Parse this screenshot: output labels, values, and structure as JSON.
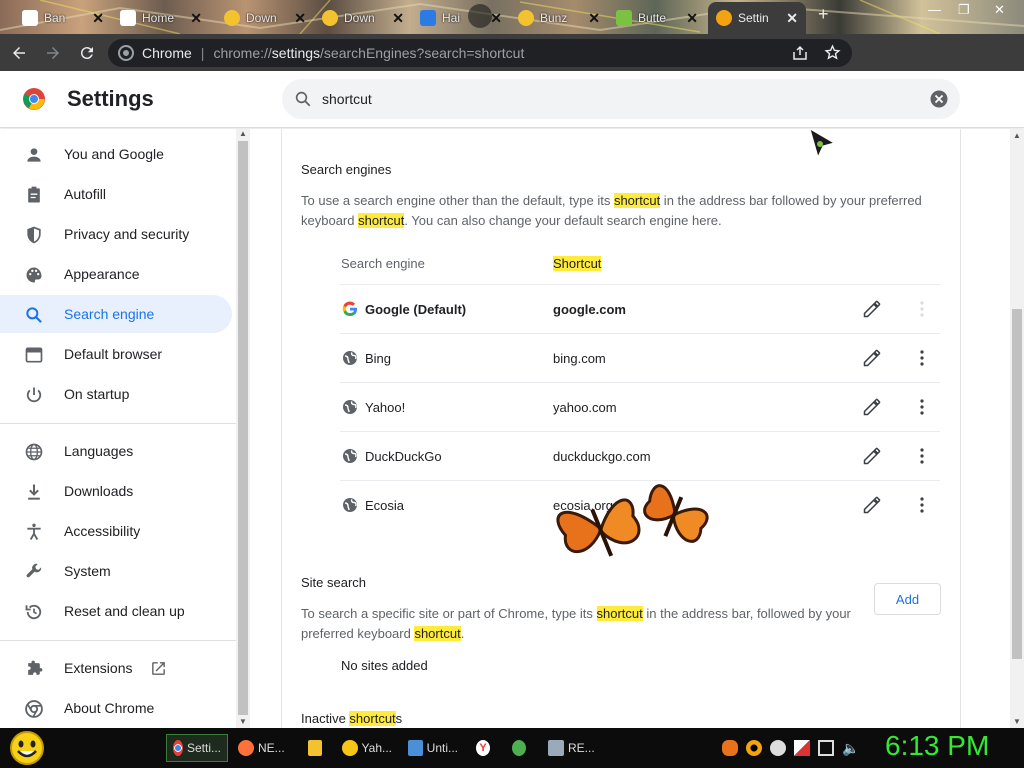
{
  "browser": {
    "tabs": [
      {
        "label": "Ban",
        "favicon_color": "#ffffff"
      },
      {
        "label": "Home",
        "favicon_color": "#ffffff"
      },
      {
        "label": "Down",
        "favicon_color": "#f2c230"
      },
      {
        "label": "Down",
        "favicon_color": "#f2c230"
      },
      {
        "label": "Hai",
        "favicon_color": "#2c7be5"
      },
      {
        "label": "Bunz",
        "favicon_color": "#f2c230"
      },
      {
        "label": "Butte",
        "favicon_color": "#7cc242"
      },
      {
        "label": "Settin",
        "favicon_color": "#f2a30f"
      }
    ],
    "active_tab_index": 7,
    "url": {
      "site": "Chrome",
      "scheme": "chrome://",
      "host": "settings",
      "path": "/searchEngines?search=shortcut"
    }
  },
  "header": {
    "title": "Settings",
    "search_value": "shortcut"
  },
  "sidebar": {
    "items": [
      {
        "label": "You and Google",
        "icon": "person-icon"
      },
      {
        "label": "Autofill",
        "icon": "clipboard-icon"
      },
      {
        "label": "Privacy and security",
        "icon": "shield-icon"
      },
      {
        "label": "Appearance",
        "icon": "palette-icon"
      },
      {
        "label": "Search engine",
        "icon": "search-icon"
      },
      {
        "label": "Default browser",
        "icon": "browser-window-icon"
      },
      {
        "label": "On startup",
        "icon": "power-icon"
      },
      {
        "label": "Languages",
        "icon": "globe-icon"
      },
      {
        "label": "Downloads",
        "icon": "download-icon"
      },
      {
        "label": "Accessibility",
        "icon": "accessibility-icon"
      },
      {
        "label": "System",
        "icon": "wrench-icon"
      },
      {
        "label": "Reset and clean up",
        "icon": "history-icon"
      },
      {
        "label": "Extensions",
        "icon": "puzzle-icon"
      },
      {
        "label": "About Chrome",
        "icon": "chrome-icon"
      }
    ],
    "selected": "Search engine"
  },
  "search_engines": {
    "heading": "Search engines",
    "description": {
      "p1": "To use a search engine other than the default, type its ",
      "hl1": "shortcut",
      "p2": " in the address bar followed by your preferred keyboard ",
      "hl2": "shortcut",
      "p3": ". You can also change your default search engine here."
    },
    "columns": {
      "engine": "Search engine",
      "shortcut": "Shortcut"
    },
    "rows": [
      {
        "name": "Google (Default)",
        "shortcut": "google.com",
        "icon": "google-icon"
      },
      {
        "name": "Bing",
        "shortcut": "bing.com",
        "icon": "globe-icon"
      },
      {
        "name": "Yahoo!",
        "shortcut": "yahoo.com",
        "icon": "globe-icon"
      },
      {
        "name": "DuckDuckGo",
        "shortcut": "duckduckgo.com",
        "icon": "globe-icon"
      },
      {
        "name": "Ecosia",
        "shortcut": "ecosia.org",
        "icon": "globe-icon"
      }
    ]
  },
  "site_search": {
    "heading": "Site search",
    "add_label": "Add",
    "description": {
      "p1": "To search a specific site or part of Chrome, type its ",
      "hl1": "shortcut",
      "p2": " in the address bar, followed by your preferred keyboard ",
      "hl2": "shortcut",
      "p3": "."
    },
    "empty": "No sites added"
  },
  "inactive": {
    "pre": "Inactive ",
    "hl": "shortcut",
    "post": "s"
  },
  "taskbar": {
    "apps": [
      {
        "label": "Setti...",
        "color": "#e94235"
      },
      {
        "label": "NE...",
        "color": "#ff7139"
      },
      {
        "label": "",
        "color": "#f2c230"
      },
      {
        "label": "Yah...",
        "color": "#f5c518"
      },
      {
        "label": "Unti...",
        "color": "#4a90d9"
      },
      {
        "label": "",
        "color": "#ff3333"
      },
      {
        "label": "",
        "color": "#4caf50"
      },
      {
        "label": "RE...",
        "color": "#9ab"
      }
    ],
    "clock": "6:13 PM"
  },
  "colors": {
    "accent": "#1a73e8",
    "highlight": "#ffeb3b",
    "clock": "#34e834"
  }
}
